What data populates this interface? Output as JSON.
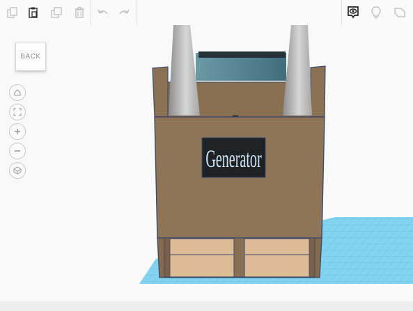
{
  "toolbar": {
    "buttons": [
      {
        "name": "copy-icon",
        "state": "disabled"
      },
      {
        "name": "paste-icon",
        "state": "enabled"
      },
      {
        "name": "duplicate-icon",
        "state": "disabled"
      },
      {
        "name": "delete-icon",
        "state": "disabled"
      },
      {
        "name": "undo-icon",
        "state": "disabled"
      },
      {
        "name": "redo-icon",
        "state": "disabled"
      }
    ],
    "right_buttons": [
      {
        "name": "notes-view-icon",
        "state": "active"
      },
      {
        "name": "lightbulb-icon",
        "state": "disabled"
      },
      {
        "name": "shape-icon",
        "state": "disabled"
      }
    ]
  },
  "viewport": {
    "back_label": "BACK",
    "nav_buttons": [
      "home-icon",
      "fit-view-icon",
      "zoom-in-icon",
      "zoom-out-icon",
      "perspective-icon"
    ]
  },
  "model": {
    "sign_text": "Generator",
    "colors": {
      "box": "#8f7557",
      "box_dark": "#7d6449",
      "box_edge": "#3b4a6b",
      "panel": "#dcbc95",
      "sign_bg": "#1f2224",
      "sign_text": "#cfe4f4",
      "grid": "#7fd2ee",
      "chimney": "#b9b9b9",
      "glass": "#4f7f8a"
    }
  }
}
